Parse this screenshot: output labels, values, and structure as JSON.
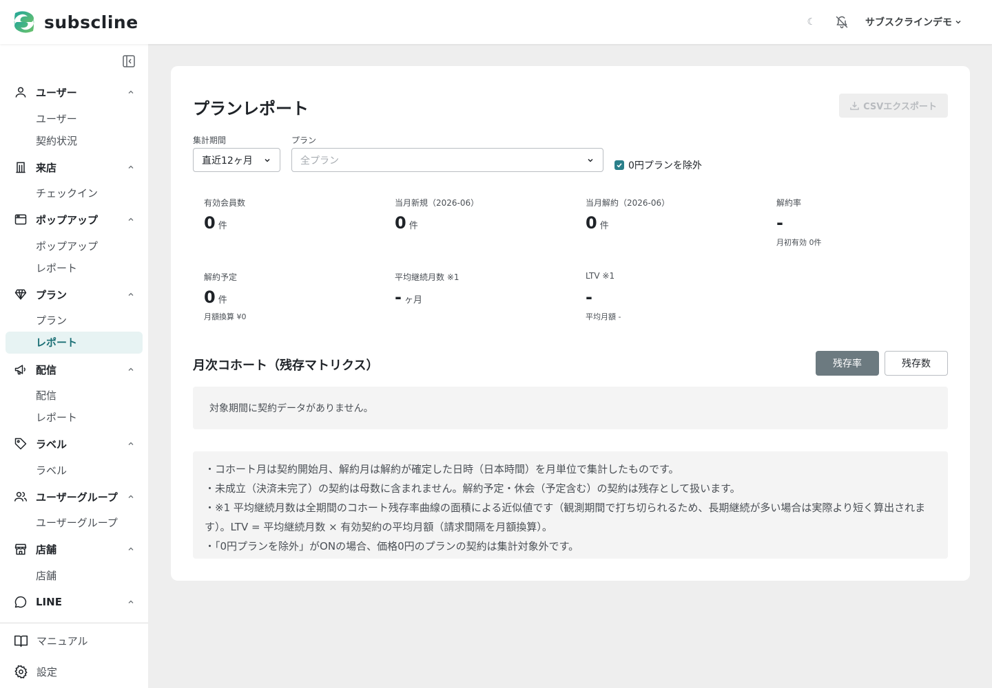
{
  "header": {
    "brand": "subscline",
    "moon_icon": "☾",
    "account_name": "サブスクラインデモ"
  },
  "sidebar": {
    "groups": [
      {
        "icon": "user-icon",
        "label": "ユーザー",
        "items": [
          "ユーザー",
          "契約状況"
        ]
      },
      {
        "icon": "building-icon",
        "label": "来店",
        "items": [
          "チェックイン"
        ]
      },
      {
        "icon": "window-icon",
        "label": "ポップアップ",
        "items": [
          "ポップアップ",
          "レポート"
        ]
      },
      {
        "icon": "diamond-icon",
        "label": "プラン",
        "items": [
          "プラン",
          "レポート"
        ]
      },
      {
        "icon": "megaphone-icon",
        "label": "配信",
        "items": [
          "配信",
          "レポート"
        ]
      },
      {
        "icon": "tag-icon",
        "label": "ラベル",
        "items": [
          "ラベル"
        ]
      },
      {
        "icon": "users-icon",
        "label": "ユーザーグループ",
        "items": [
          "ユーザーグループ"
        ]
      },
      {
        "icon": "store-icon",
        "label": "店舗",
        "items": [
          "店舗"
        ]
      },
      {
        "icon": "chat-icon",
        "label": "LINE",
        "items": []
      }
    ],
    "active_item": "プラン / レポート",
    "bottom": {
      "manual": "マニュアル",
      "settings": "設定"
    }
  },
  "page": {
    "title": "プランレポート",
    "csv_export": "CSVエクスポート",
    "filters": {
      "period_label": "集計期間",
      "period_value": "直近12ヶ月",
      "plan_label": "プラン",
      "plan_placeholder": "全プラン",
      "exclude_zero_label": "0円プランを除外",
      "exclude_zero_checked": true
    },
    "stats": [
      {
        "label": "有効会員数",
        "value": "0",
        "unit": "件",
        "sub": ""
      },
      {
        "label": "当月新規（2026-06）",
        "value": "0",
        "unit": "件",
        "sub": ""
      },
      {
        "label": "当月解約（2026-06）",
        "value": "0",
        "unit": "件",
        "sub": ""
      },
      {
        "label": "解約率",
        "value": "-",
        "unit": "",
        "sub": "月初有効 0件"
      },
      {
        "label": "解約予定",
        "value": "0",
        "unit": "件",
        "sub": "月額換算 ¥0"
      },
      {
        "label": "平均継続月数 ※1",
        "value": "-",
        "unit": "ヶ月",
        "sub": ""
      },
      {
        "label": "LTV ※1",
        "value": "-",
        "unit": "",
        "sub": "平均月額 -"
      }
    ],
    "cohort": {
      "title": "月次コホート（残存マトリクス）",
      "toggle_rate": "残存率",
      "toggle_count": "残存数",
      "active_toggle": "残存率",
      "empty_message": "対象期間に契約データがありません。"
    },
    "notes": [
      "・コホート月は契約開始月、解約月は解約が確定した日時（日本時間）を月単位で集計したものです。",
      "・未成立（決済未完了）の契約は母数に含まれません。解約予定・休会（予定含む）の契約は残存として扱います。",
      "・※1 平均継続月数は全期間のコホート残存率曲線の面積による近似値です（観測期間で打ち切られるため、長期継続が多い場合は実際より短く算出されます）。LTV = 平均継続月数 × 有効契約の平均月額（請求間隔を月額換算）。",
      "・「0円プランを除外」がONの場合、価格0円のプランの契約は集計対象外です。"
    ]
  },
  "colors": {
    "accent": "#1b6f75",
    "active_bg": "#e7f3f3",
    "toggle_on": "#6c7a80",
    "checkbox": "#2a7f8a"
  }
}
